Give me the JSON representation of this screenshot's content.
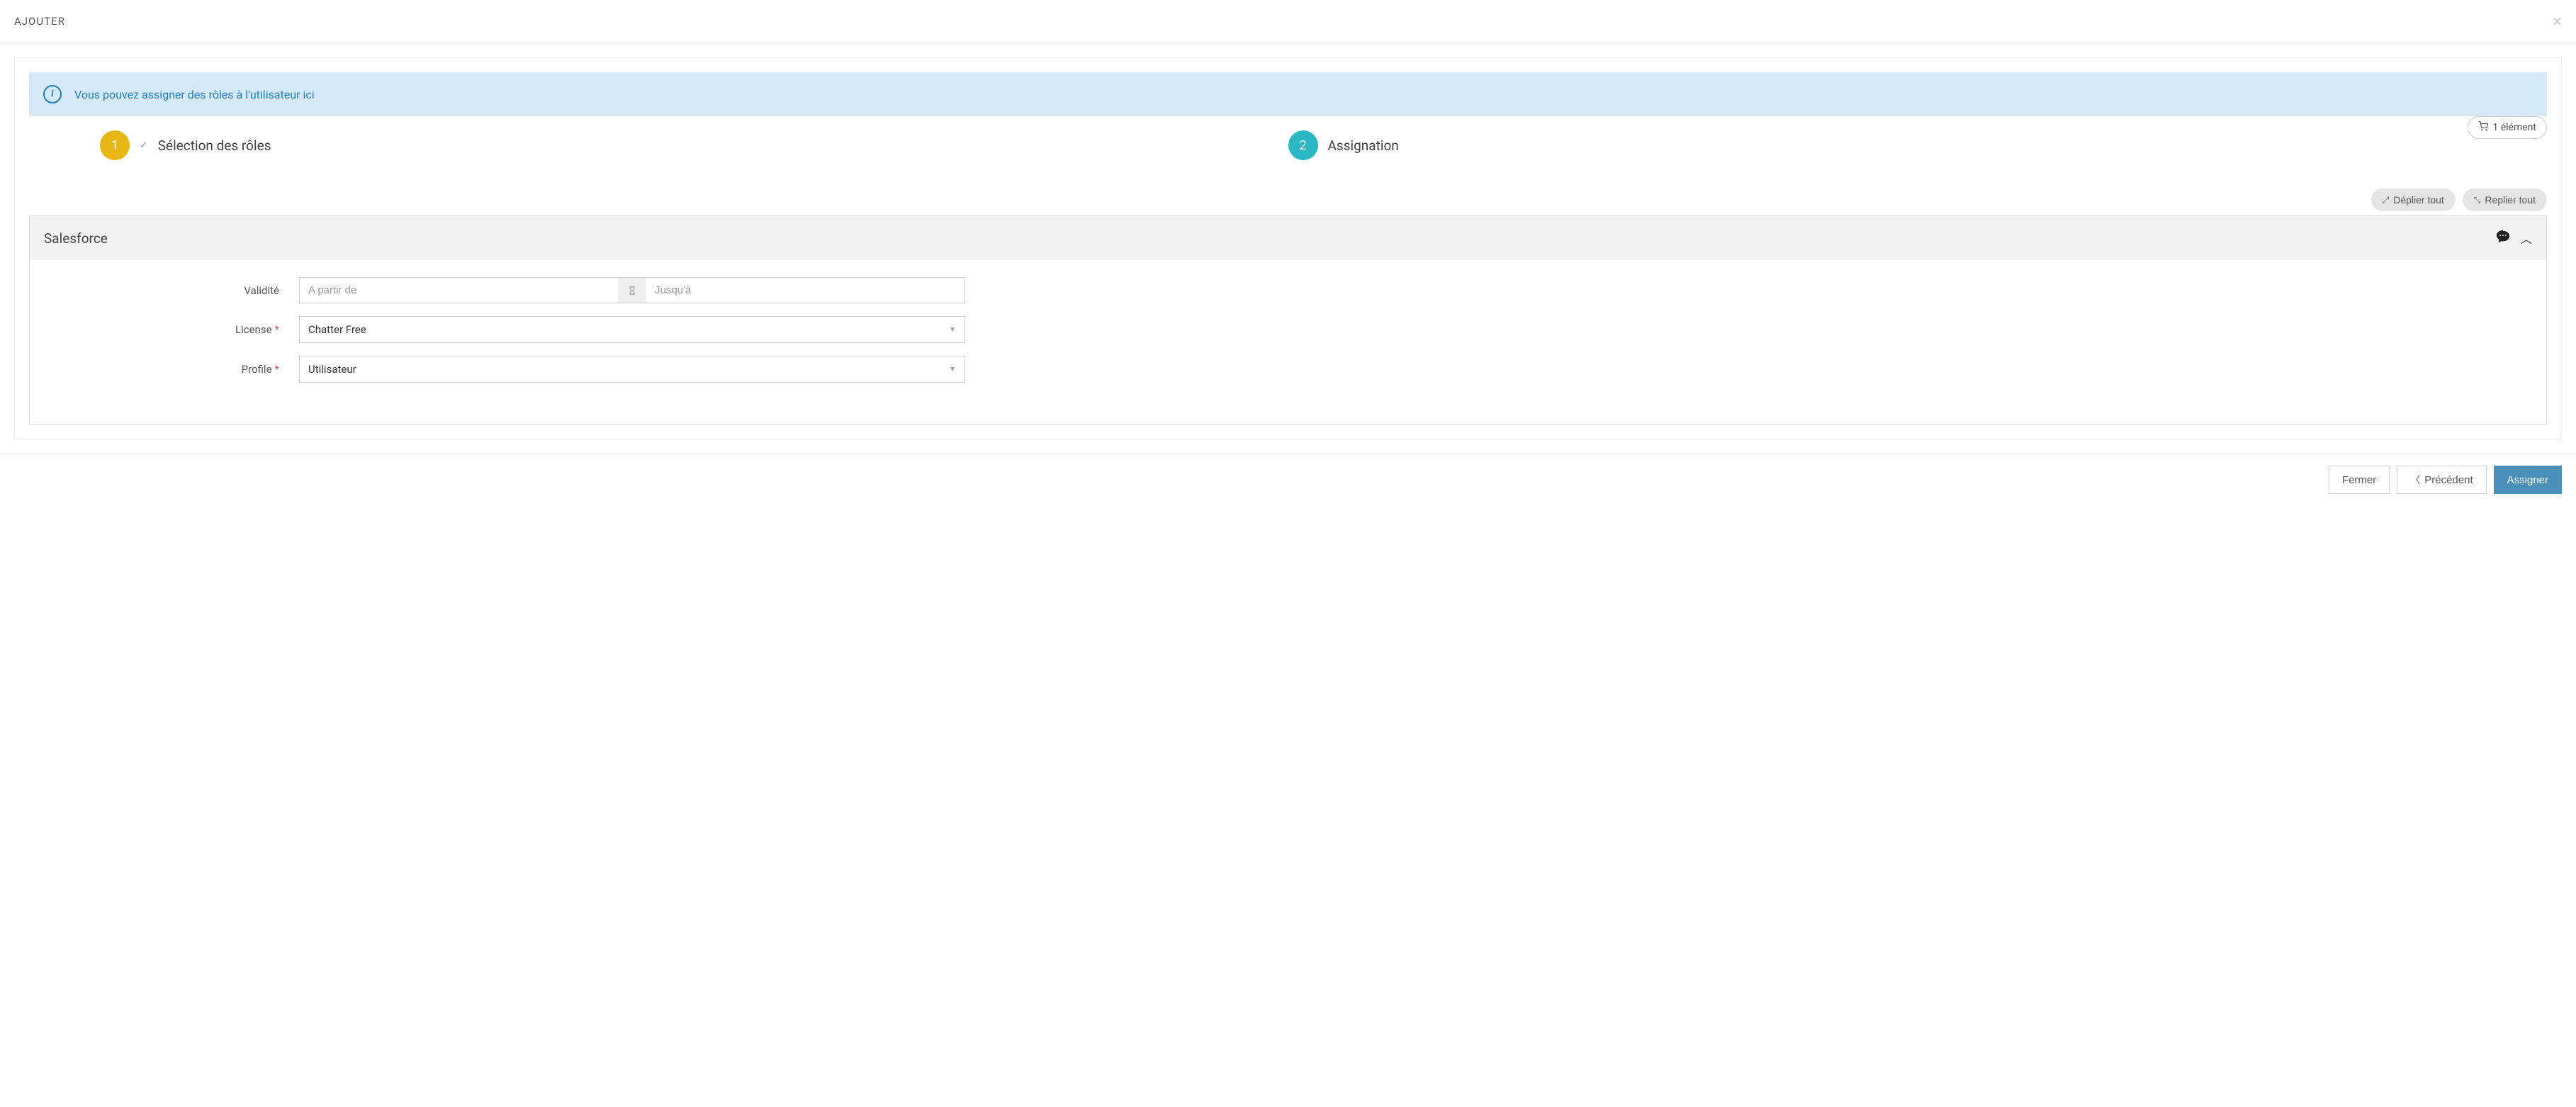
{
  "header": {
    "title": "AJOUTER"
  },
  "banner": {
    "text": "Vous pouvez assigner des rôles à l'utilisateur ici"
  },
  "stepper": {
    "step1": {
      "num": "1",
      "label": "Sélection des rôles"
    },
    "step2": {
      "num": "2",
      "label": "Assignation"
    }
  },
  "cart": {
    "label": "1 élément"
  },
  "controls": {
    "expand": "Déplier tout",
    "collapse": "Replier tout"
  },
  "panel": {
    "title": "Salesforce",
    "fields": {
      "validity": {
        "label": "Validité",
        "from_placeholder": "A partir de",
        "to_placeholder": "Jusqu'à"
      },
      "license": {
        "label": "License",
        "value": "Chatter Free"
      },
      "profile": {
        "label": "Profile",
        "value": "Utilisateur"
      }
    }
  },
  "footer": {
    "close": "Fermer",
    "prev": "Précédent",
    "assign": "Assigner"
  }
}
